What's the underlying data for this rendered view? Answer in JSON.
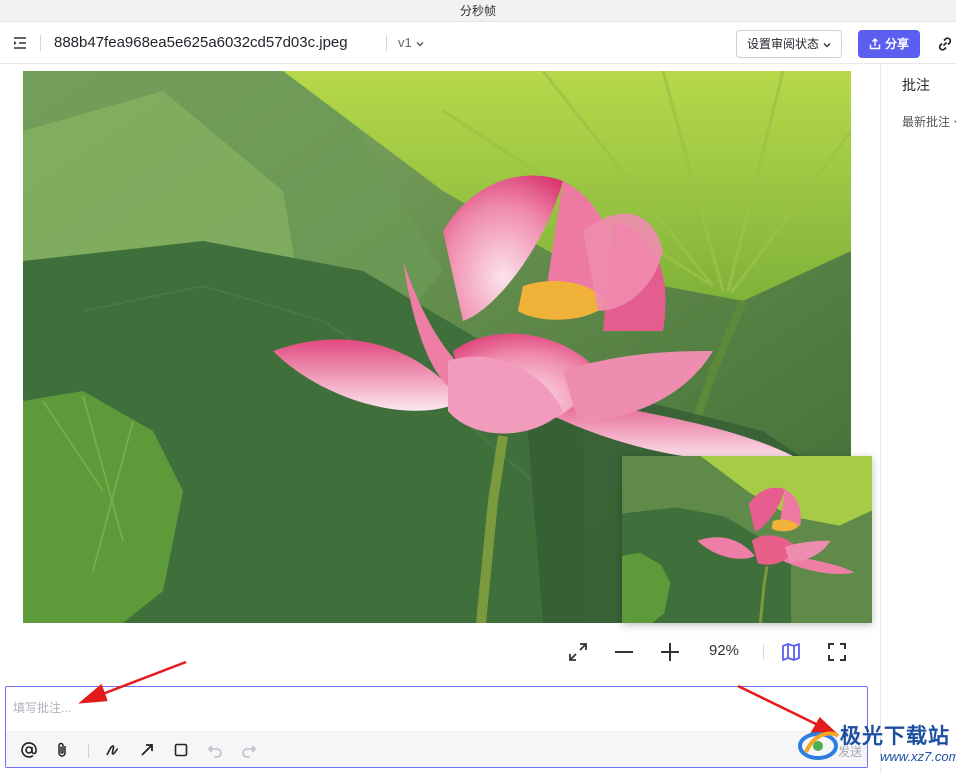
{
  "window": {
    "title": "分秒帧"
  },
  "toolbar": {
    "filename": "888b47fea968ea5e625a6032cd57d03c.jpeg",
    "version": "v1",
    "review_status_label": "设置审阅状态",
    "share_label": "分享",
    "icons": [
      "collapse-sidebar-icon",
      "chevron-down-icon",
      "share-icon",
      "link-icon"
    ]
  },
  "right_panel": {
    "title": "批注",
    "sort_filter": "最新批注"
  },
  "viewer": {
    "image_subject": "pink lotus flower",
    "zoom_percent": "92%",
    "controls": [
      "fit-screen-icon",
      "zoom-out-icon",
      "zoom-in-icon",
      "minimap-icon",
      "fullscreen-icon"
    ]
  },
  "comment": {
    "placeholder": "填写批注...",
    "value": "",
    "send_label": "发送",
    "tools": [
      "at-mention-icon",
      "attachment-icon",
      "draw-pen-icon",
      "arrow-tool-icon",
      "rectangle-tool-icon",
      "undo-icon",
      "redo-icon"
    ]
  },
  "watermark": {
    "text": "极光下载站",
    "url": "www.xz7.com"
  },
  "colors": {
    "accent": "#5b5ff0",
    "annotation_arrow": "#e31b1b",
    "lotus_pink": "#e8608a",
    "leaf_green": "#5c8a3a"
  }
}
